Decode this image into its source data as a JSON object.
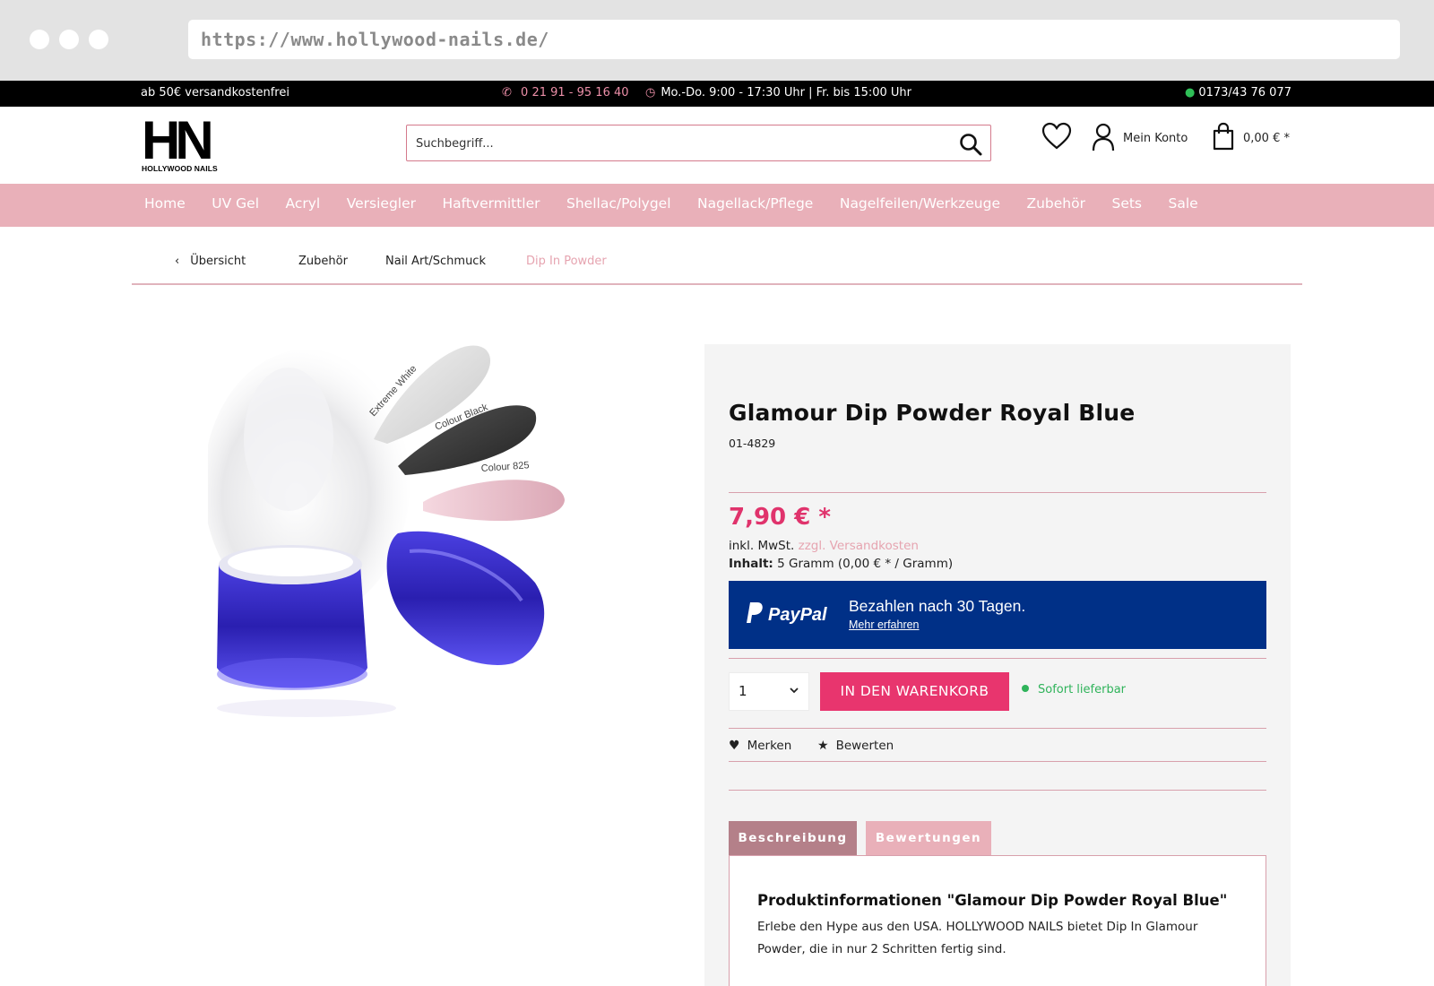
{
  "browser": {
    "url": "https://www.hollywood-nails.de/"
  },
  "topbar": {
    "shipping": "ab 50€ versandkostenfrei",
    "phone": "0 21 91 - 95 16 40",
    "hours": "Mo.-Do. 9:00 - 17:30 Uhr | Fr. bis 15:00 Uhr",
    "whatsapp": "0173/43 76 077"
  },
  "header": {
    "logo_mark": "HN",
    "logo_text": "HOLLYWOOD NAILS",
    "search_placeholder": "Suchbegriff...",
    "account_label": "Mein Konto",
    "cart_total": "0,00 € *"
  },
  "nav": {
    "items": [
      "Home",
      "UV Gel",
      "Acryl",
      "Versiegler",
      "Haftvermittler",
      "Shellac/Polygel",
      "Nagellack/Pflege",
      "Nagelfeilen/Werkzeuge",
      "Zubehör",
      "Sets",
      "Sale"
    ]
  },
  "breadcrumb": {
    "back": "Übersicht",
    "items": [
      "Zubehör",
      "Nail Art/Schmuck",
      "Dip In Powder"
    ]
  },
  "product": {
    "image_labels": [
      "Extreme White",
      "Colour Black",
      "Colour 825"
    ],
    "title": "Glamour Dip Powder Royal Blue",
    "sku": "01-4829",
    "price": "7,90 € *",
    "tax_prefix": "inkl. MwSt.",
    "shipping_link": "zzgl. Versandkosten",
    "content_label": "Inhalt:",
    "content_value": "5 Gramm (0,00 € * / Gramm)",
    "paypal_logo": "PayPal",
    "paypal_headline": "Bezahlen nach 30 Tagen.",
    "paypal_link": "Mehr erfahren",
    "quantity": "1",
    "add_to_cart": "IN DEN WARENKORB",
    "availability": "Sofort lieferbar",
    "remember": "Merken",
    "rate": "Bewerten",
    "tabs": [
      "Beschreibung",
      "Bewertungen"
    ],
    "desc_heading": "Produktinformationen \"Glamour Dip Powder Royal Blue\"",
    "desc_text": "Erlebe den Hype aus den USA. HOLLYWOOD NAILS bietet Dip In Glamour Powder, die in nur 2 Schritten fertig sind."
  },
  "colors": {
    "accent_pink": "#e8356e",
    "nav_pink": "#e9b0b9",
    "paypal_blue": "#003087",
    "availability_green": "#2fb35a"
  }
}
